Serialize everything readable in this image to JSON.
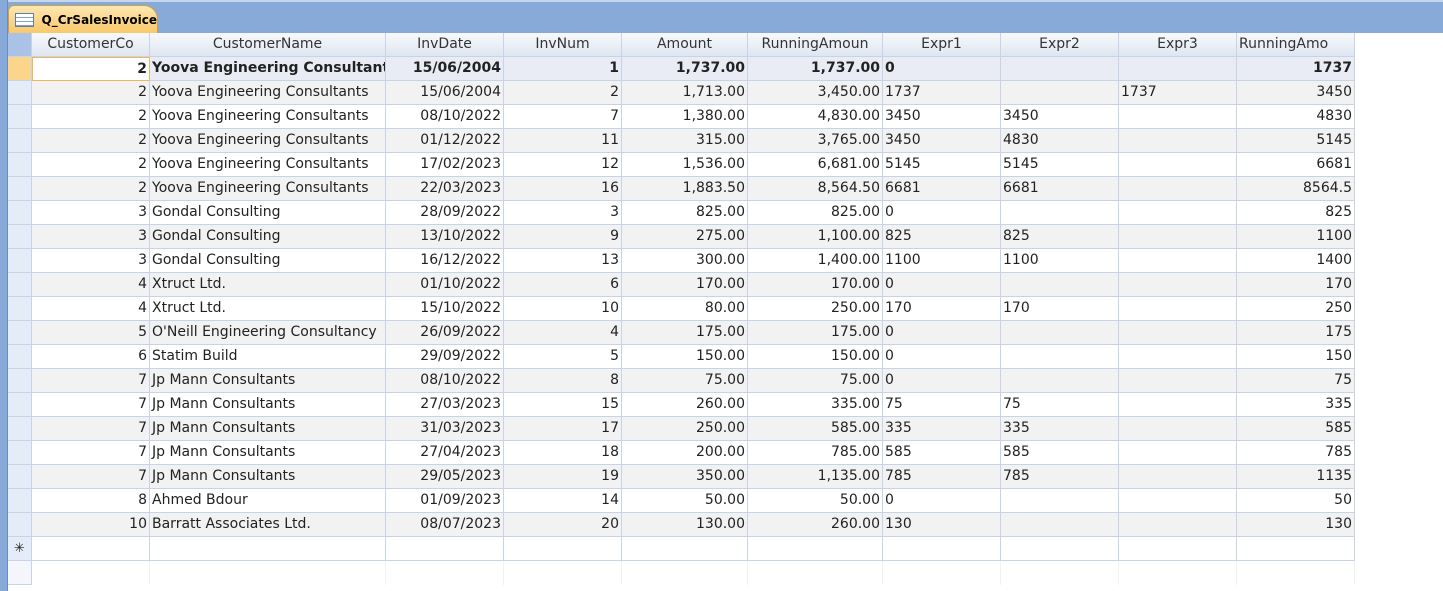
{
  "tab": {
    "title": "Q_CrSalesInvoice"
  },
  "columns": [
    "CustomerCo",
    "CustomerName",
    "InvDate",
    "InvNum",
    "Amount",
    "RunningAmoun",
    "Expr1",
    "Expr2",
    "Expr3",
    "RunningAmo"
  ],
  "new_row_marker": "✳",
  "rows": [
    [
      "2",
      "Yoova Engineering Consultants",
      "15/06/2004",
      "1",
      "1,737.00",
      "1,737.00",
      "0",
      "",
      "",
      "1737"
    ],
    [
      "2",
      "Yoova Engineering Consultants",
      "15/06/2004",
      "2",
      "1,713.00",
      "3,450.00",
      "1737",
      "",
      "1737",
      "3450"
    ],
    [
      "2",
      "Yoova Engineering Consultants",
      "08/10/2022",
      "7",
      "1,380.00",
      "4,830.00",
      "3450",
      "3450",
      "",
      "4830"
    ],
    [
      "2",
      "Yoova Engineering Consultants",
      "01/12/2022",
      "11",
      "315.00",
      "3,765.00",
      "3450",
      "4830",
      "",
      "5145"
    ],
    [
      "2",
      "Yoova Engineering Consultants",
      "17/02/2023",
      "12",
      "1,536.00",
      "6,681.00",
      "5145",
      "5145",
      "",
      "6681"
    ],
    [
      "2",
      "Yoova Engineering Consultants",
      "22/03/2023",
      "16",
      "1,883.50",
      "8,564.50",
      "6681",
      "6681",
      "",
      "8564.5"
    ],
    [
      "3",
      "Gondal Consulting",
      "28/09/2022",
      "3",
      "825.00",
      "825.00",
      "0",
      "",
      "",
      "825"
    ],
    [
      "3",
      "Gondal Consulting",
      "13/10/2022",
      "9",
      "275.00",
      "1,100.00",
      "825",
      "825",
      "",
      "1100"
    ],
    [
      "3",
      "Gondal Consulting",
      "16/12/2022",
      "13",
      "300.00",
      "1,400.00",
      "1100",
      "1100",
      "",
      "1400"
    ],
    [
      "4",
      "Xtruct Ltd.",
      "01/10/2022",
      "6",
      "170.00",
      "170.00",
      "0",
      "",
      "",
      "170"
    ],
    [
      "4",
      "Xtruct Ltd.",
      "15/10/2022",
      "10",
      "80.00",
      "250.00",
      "170",
      "170",
      "",
      "250"
    ],
    [
      "5",
      "O'Neill Engineering Consultancy",
      "26/09/2022",
      "4",
      "175.00",
      "175.00",
      "0",
      "",
      "",
      "175"
    ],
    [
      "6",
      "Statim Build",
      "29/09/2022",
      "5",
      "150.00",
      "150.00",
      "0",
      "",
      "",
      "150"
    ],
    [
      "7",
      "Jp Mann Consultants",
      "08/10/2022",
      "8",
      "75.00",
      "75.00",
      "0",
      "",
      "",
      "75"
    ],
    [
      "7",
      "Jp Mann Consultants",
      "27/03/2023",
      "15",
      "260.00",
      "335.00",
      "75",
      "75",
      "",
      "335"
    ],
    [
      "7",
      "Jp Mann Consultants",
      "31/03/2023",
      "17",
      "250.00",
      "585.00",
      "335",
      "335",
      "",
      "585"
    ],
    [
      "7",
      "Jp Mann Consultants",
      "27/04/2023",
      "18",
      "200.00",
      "785.00",
      "585",
      "585",
      "",
      "785"
    ],
    [
      "7",
      "Jp Mann Consultants",
      "29/05/2023",
      "19",
      "350.00",
      "1,135.00",
      "785",
      "785",
      "",
      "1135"
    ],
    [
      "8",
      "Ahmed Bdour",
      "01/09/2023",
      "14",
      "50.00",
      "50.00",
      "0",
      "",
      "",
      "50"
    ],
    [
      "10",
      "Barratt Associates Ltd.",
      "08/07/2023",
      "20",
      "130.00",
      "260.00",
      "130",
      "",
      "",
      "130"
    ]
  ]
}
